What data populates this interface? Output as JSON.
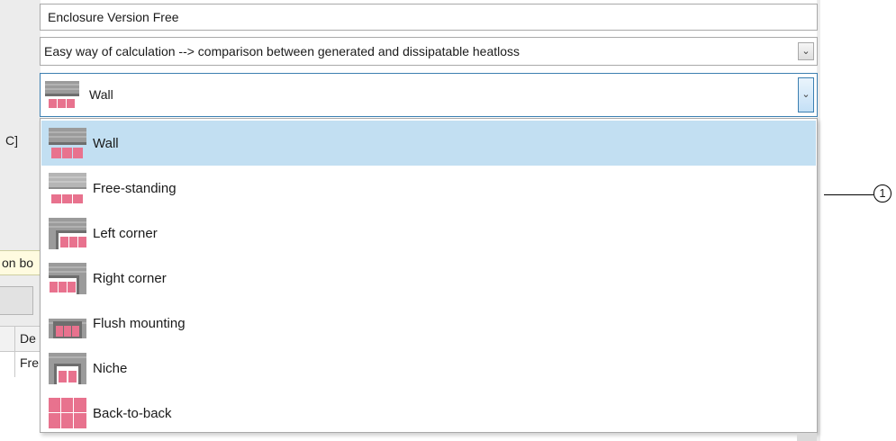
{
  "background_fragments": {
    "bracket": "C]",
    "tooltip": "on bo",
    "grid_header": "De",
    "grid_cell": "Fre"
  },
  "enclosure_field": {
    "value": "Enclosure Version Free"
  },
  "calculation_dropdown": {
    "value": "Easy way of calculation --> comparison between generated and dissipatable heatloss",
    "arrow_icon": "chevron-down-icon"
  },
  "mounting_dropdown": {
    "selected": "Wall",
    "arrow_icon": "chevron-down-icon",
    "options": [
      {
        "label": "Wall",
        "icon": "wall-mount-icon"
      },
      {
        "label": "Free-standing",
        "icon": "free-standing-icon"
      },
      {
        "label": "Left corner",
        "icon": "left-corner-icon"
      },
      {
        "label": "Right corner",
        "icon": "right-corner-icon"
      },
      {
        "label": "Flush mounting",
        "icon": "flush-mounting-icon"
      },
      {
        "label": "Niche",
        "icon": "niche-icon"
      },
      {
        "label": "Back-to-back",
        "icon": "back-to-back-icon"
      }
    ],
    "highlighted_index": 0
  },
  "callout": {
    "number": "1"
  },
  "colors": {
    "selection": "#c2dff2",
    "focus_border": "#3c7fb1",
    "cabinet_pink": "#e8728e",
    "wall_gray": "#9b9b9b"
  }
}
